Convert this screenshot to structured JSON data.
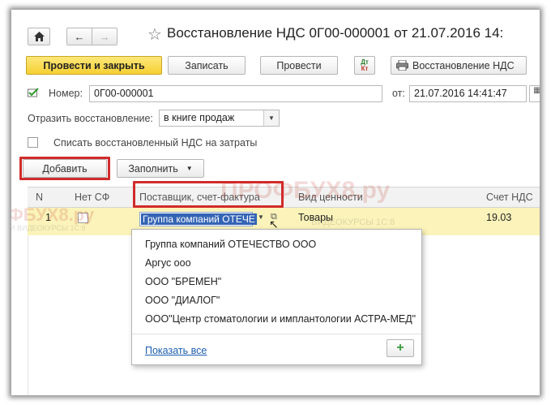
{
  "window": {
    "title": "Восстановление НДС 0Г00-000001 от 21.07.2016 14:"
  },
  "toolbar": {
    "post_and_close": "Провести и закрыть",
    "save": "Записать",
    "post": "Провести",
    "dt_kt_top": "Дт",
    "dt_kt_bottom": "Кт",
    "print_label": "Восстановление НДС"
  },
  "header": {
    "number_label": "Номер:",
    "number_value": "0Г00-000001",
    "date_label": "от:",
    "date_value": "21.07.2016 14:41:47",
    "reflect_label": "Отразить восстановление:",
    "reflect_value": "в книге продаж",
    "writeoff_label": "Списать восстановленный НДС на затраты"
  },
  "table_toolbar": {
    "add": "Добавить",
    "fill": "Заполнить"
  },
  "table": {
    "columns": [
      "N",
      "Нет СФ",
      "Поставщик, счет-фактура",
      "Вид ценности",
      "Счет НДС"
    ],
    "rows": [
      {
        "n": "1",
        "supplier": "Группа компаний ОТЕЧЕ",
        "value_type": "Товары",
        "vat_account": "19.03"
      }
    ]
  },
  "dropdown": {
    "items": [
      "Группа компаний ОТЕЧЕСТВО ООО",
      "Аргус ооо",
      "ООО \"БРЕМЕН\"",
      "ООО \"ДИАЛОГ\"",
      "ООО\"Центр стоматологии и имплантологии АСТРА-МЕД\""
    ],
    "show_all": "Показать все",
    "add_symbol": "+"
  },
  "watermark": {
    "main": "ПРОФБУХ8.ру",
    "left": "ФБУХ8.ру",
    "sub_left": "И ВИДЕОКУРСЫ 1С:8",
    "sub_right": "ВИДЕОКУРСЫ 1С:8"
  },
  "colors": {
    "primary_button": "#f5cf33",
    "highlight_row": "#fbf3b9",
    "red_frame": "#d12b2b",
    "link": "#1c5db0",
    "selection": "#3464b4"
  }
}
